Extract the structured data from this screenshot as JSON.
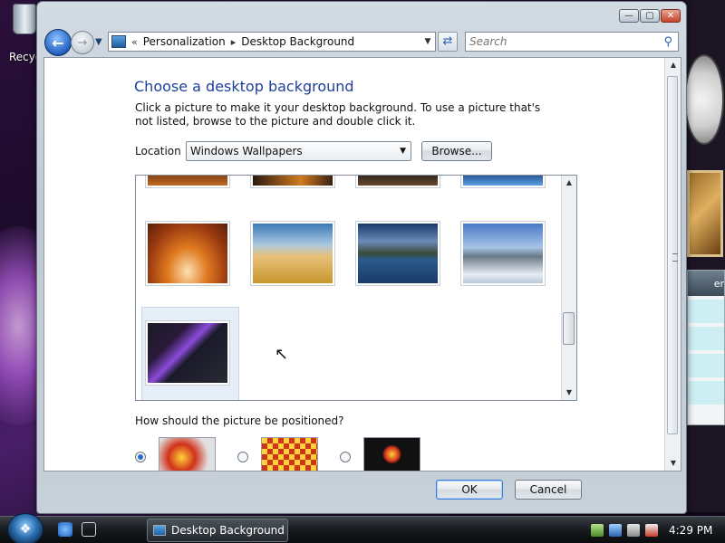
{
  "desktop": {
    "recycle_label": "Recyc"
  },
  "gadgets": {
    "feed_header": "er"
  },
  "window": {
    "controls": {
      "minimize": "—",
      "maximize": "▢",
      "close": "✕"
    },
    "address": {
      "sep": "«",
      "crumbs": [
        "Personalization",
        "Desktop Background"
      ],
      "sep2": "▸"
    },
    "search": {
      "placeholder": "Search"
    }
  },
  "content": {
    "title": "Choose a desktop background",
    "description": "Click a picture to make it your desktop background. To use a picture that's not listed, browse to the picture and double click it.",
    "location_label": "Location",
    "location_value": "Windows Wallpapers",
    "browse_label": "Browse...",
    "position_question": "How should the picture be positioned?",
    "position_options": [
      {
        "name": "fit-to-screen",
        "selected": true
      },
      {
        "name": "tile",
        "selected": false
      },
      {
        "name": "center",
        "selected": false
      }
    ],
    "ok_label": "OK",
    "cancel_label": "Cancel"
  },
  "taskbar": {
    "task_label": "Desktop Background",
    "clock": "4:29 PM"
  },
  "colors": {
    "title_blue": "#1e3f9a",
    "accent": "#2a63b0"
  }
}
